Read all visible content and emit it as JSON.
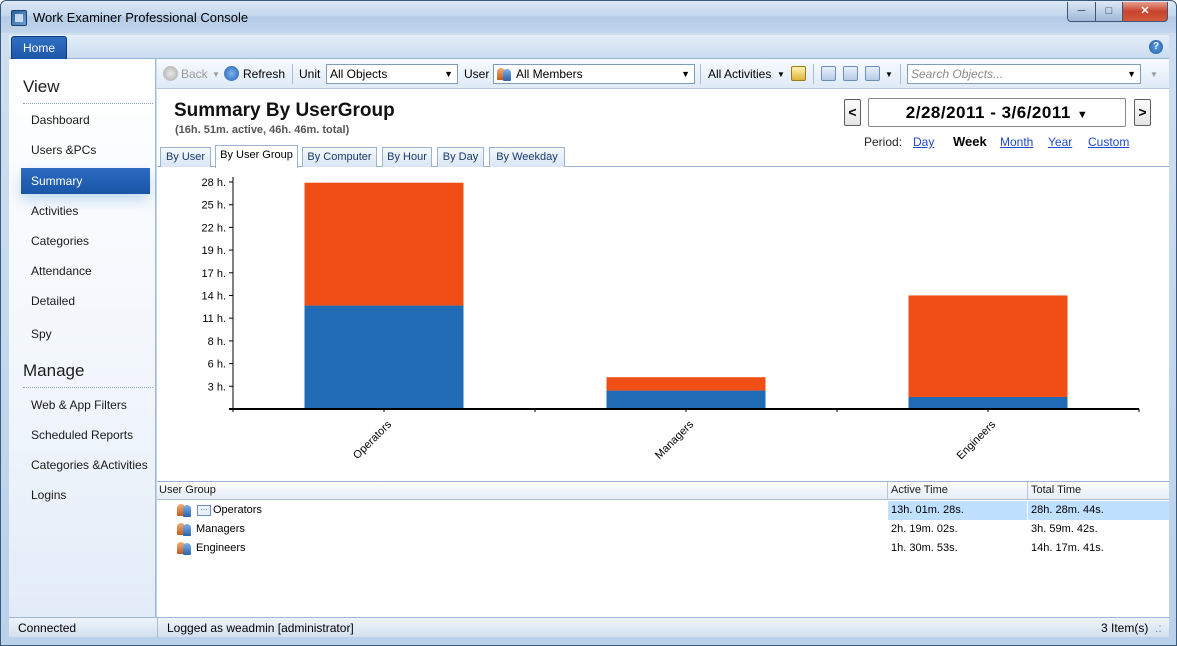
{
  "window": {
    "title": "Work Examiner Professional Console"
  },
  "ribbon": {
    "home_tab": "Home"
  },
  "sidebar": {
    "view_header": "View",
    "view_items": [
      "Dashboard",
      "Users &PCs",
      "Summary",
      "Activities",
      "Categories",
      "Attendance",
      "Detailed",
      "Spy"
    ],
    "manage_header": "Manage",
    "manage_items": [
      "Web & App Filters",
      "Scheduled Reports",
      "Categories &Activities",
      "Logins"
    ],
    "active_item": "Summary"
  },
  "toolbar": {
    "back": "Back",
    "refresh": "Refresh",
    "unit_label": "Unit",
    "unit_value": "All Objects",
    "user_label": "User",
    "user_value": "All Members",
    "activities": "All Activities",
    "search_placeholder": "Search Objects..."
  },
  "report": {
    "title": "Summary By UserGroup",
    "subtitle": "(16h. 51m. active, 46h. 46m. total)",
    "date_range": "2/28/2011 - 3/6/2011",
    "prev": "<",
    "next": ">",
    "period_label": "Period:",
    "periods": [
      "Day",
      "Week",
      "Month",
      "Year",
      "Custom"
    ],
    "selected_period": "Week"
  },
  "tabs": [
    "By User",
    "By User Group",
    "By Computer",
    "By Hour",
    "By Day",
    "By Weekday"
  ],
  "active_tab": "By User Group",
  "chart_data": {
    "type": "bar",
    "stacked": true,
    "categories": [
      "Operators",
      "Managers",
      "Engineers"
    ],
    "series": [
      {
        "values": [
          13.02,
          2.32,
          1.51
        ],
        "color": "#1f6bb5"
      },
      {
        "values": [
          15.46,
          1.68,
          12.78
        ],
        "color": "#f04e14"
      }
    ],
    "yticks": [
      "3 h.",
      "6 h.",
      "8 h.",
      "11 h.",
      "14 h.",
      "17 h.",
      "19 h.",
      "22 h.",
      "25 h.",
      "28 h."
    ],
    "ytick_values": [
      2.86,
      5.71,
      8.57,
      11.43,
      14.29,
      17.14,
      20.0,
      22.86,
      25.71,
      28.57
    ],
    "ylim": [
      0,
      29.2
    ]
  },
  "grid": {
    "columns": [
      "User Group",
      "Active Time",
      "Total Time"
    ],
    "rows": [
      {
        "group": "Operators",
        "active": "13h. 01m. 28s.",
        "total": "28h. 28m. 44s."
      },
      {
        "group": "Managers",
        "active": "2h. 19m. 02s.",
        "total": "3h. 59m. 42s."
      },
      {
        "group": "Engineers",
        "active": "1h. 30m. 53s.",
        "total": "14h. 17m. 41s."
      }
    ]
  },
  "status": {
    "connection": "Connected",
    "login": "Logged as weadmin [administrator]",
    "items": "3 Item(s)"
  }
}
